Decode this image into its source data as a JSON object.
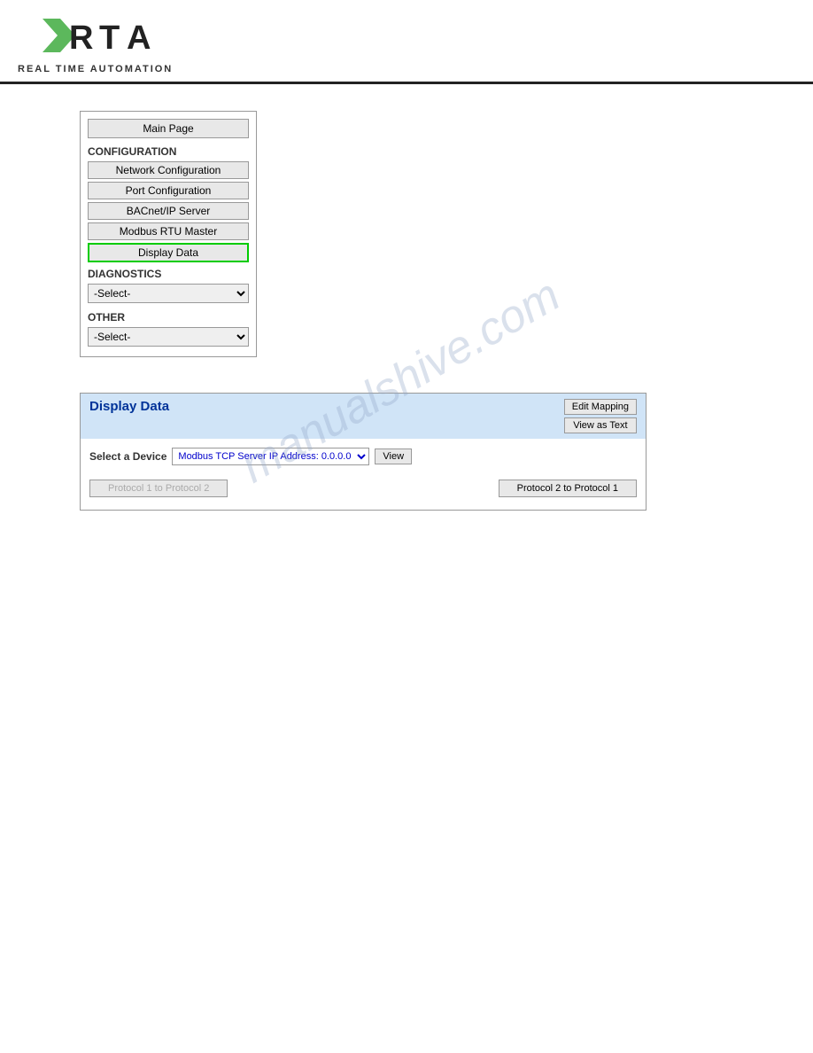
{
  "header": {
    "logo_text": "REAL TIME AUTOMATION"
  },
  "nav": {
    "main_page_label": "Main Page",
    "configuration_label": "CONFIGURATION",
    "config_items": [
      {
        "label": "Network Configuration",
        "active": false
      },
      {
        "label": "Port Configuration",
        "active": false
      },
      {
        "label": "BACnet/IP Server",
        "active": false
      },
      {
        "label": "Modbus RTU Master",
        "active": false
      },
      {
        "label": "Display Data",
        "active": true
      }
    ],
    "diagnostics_label": "DIAGNOSTICS",
    "diagnostics_default": "-Select-",
    "other_label": "OTHER",
    "other_default": "-Select-"
  },
  "display_data": {
    "title": "Display Data",
    "edit_mapping_label": "Edit Mapping",
    "view_as_text_label": "View as Text",
    "select_device_label": "Select a Device",
    "device_option": "Modbus TCP Server IP Address: 0.0.0.0",
    "view_button_label": "View",
    "protocol1_to_protocol2": "Protocol 1 to Protocol 2",
    "protocol2_to_protocol1": "Protocol 2 to Protocol 1"
  },
  "watermark": {
    "text": "manualshive.com"
  }
}
